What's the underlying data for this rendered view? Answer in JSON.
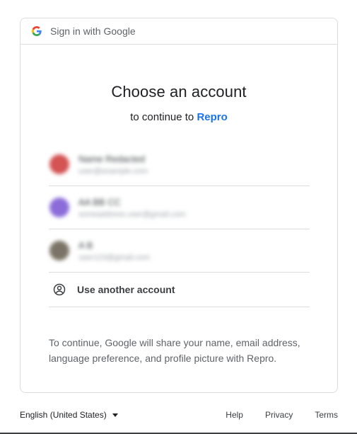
{
  "header": {
    "text": "Sign in with Google",
    "logo_icon": "google-g-icon"
  },
  "title": "Choose an account",
  "subtitle": {
    "prefix": "to continue to",
    "app_name": "Repro"
  },
  "accounts": [
    {
      "name": "Name Redacted",
      "email": "user@example.com",
      "avatar_color": "#d45353"
    },
    {
      "name": "AA BB CC",
      "email": "someaddress.user@gmail.com",
      "avatar_color": "#8b6cd9"
    },
    {
      "name": "A B",
      "email": "user123@gmail.com",
      "avatar_color": "#7b7466"
    }
  ],
  "use_another": {
    "label": "Use another account",
    "icon": "account-circle-icon"
  },
  "consent_text": "To continue, Google will share your name, email address, language preference, and profile picture with Repro.",
  "footer": {
    "language": "English (United States)",
    "links": {
      "help": "Help",
      "privacy": "Privacy",
      "terms": "Terms"
    }
  },
  "colors": {
    "accent": "#1a73e8",
    "border": "#dadce0",
    "muted": "#5f6368"
  }
}
